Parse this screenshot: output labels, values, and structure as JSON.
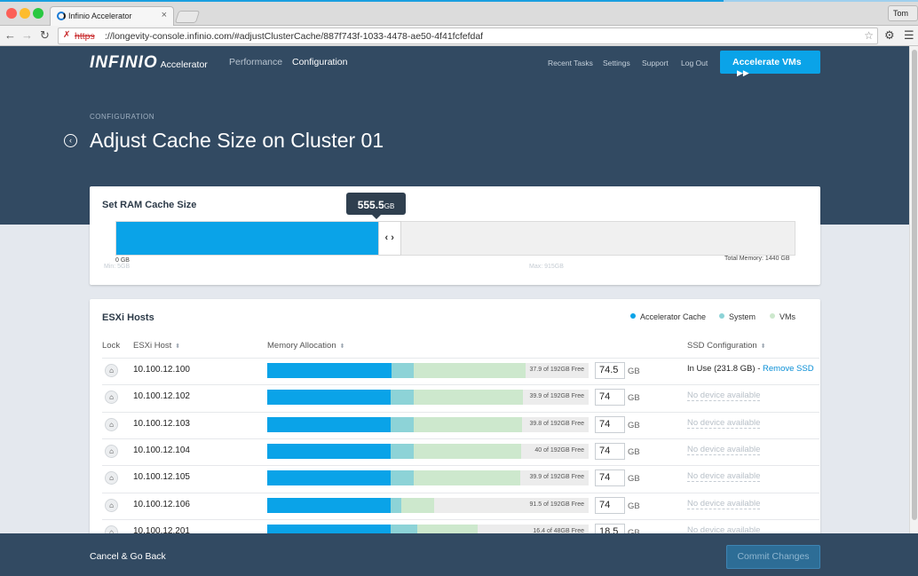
{
  "browser": {
    "tab_title": "Infinio Accelerator",
    "tab_close": "×",
    "profile": "Tom",
    "url_scheme": "https",
    "url_rest": "://longevity-console.infinio.com/#adjustClusterCache/887f743f-1033-4478-ae50-4f41fcfefdaf",
    "icons": {
      "back": "arrow-left",
      "forward": "arrow-right",
      "reload": "reload",
      "bookmark": "star",
      "settings": "gear",
      "menu": "hamburger"
    }
  },
  "header": {
    "logo": "INFINIO",
    "product": "Accelerator",
    "nav": [
      "Performance",
      "Configuration"
    ],
    "links": [
      "Recent Tasks",
      "Settings",
      "Support",
      "Log Out"
    ],
    "accelerate_button": "Accelerate VMs",
    "accelerate_icon": "▶▶",
    "breadcrumb": "CONFIGURATION",
    "title": "Adjust Cache Size on Cluster 01"
  },
  "ram_cache": {
    "title": "Set RAM Cache Size",
    "tooltip_value": "555.5",
    "tooltip_unit": "GB",
    "handle_icon": "‹ ›",
    "fill_fraction": 0.3857,
    "min_label": "0 GB",
    "min_faint": "Min: 5GB",
    "max_faint": "Max: 915GB",
    "total_label": "Total Memory: 1440 GB"
  },
  "hosts": {
    "title": "ESXi Hosts",
    "legend": [
      {
        "label": "Accelerator Cache",
        "color": "#0aa3e8"
      },
      {
        "label": "System",
        "color": "#8dd3d7"
      },
      {
        "label": "VMs",
        "color": "#cde8cd"
      }
    ],
    "columns": [
      "Lock",
      "ESXi Host",
      "Memory Allocation",
      "SSD Configuration"
    ],
    "sort_icon": "⬍",
    "unit": "GB",
    "rows": [
      {
        "ip": "10.100.12.100",
        "acc": 0.388,
        "sys": 0.069,
        "vms": 0.348,
        "free": "37.9 of 192GB Free",
        "gb": "74.5",
        "ssd_status": "In Use (231.8 GB) - ",
        "ssd_link": "Remove SSD"
      },
      {
        "ip": "10.100.12.102",
        "acc": 0.385,
        "sys": 0.072,
        "vms": 0.338,
        "free": "39.9 of 192GB Free",
        "gb": "74",
        "ssd_none": "No device available"
      },
      {
        "ip": "10.100.12.103",
        "acc": 0.385,
        "sys": 0.072,
        "vms": 0.337,
        "free": "39.8 of 192GB Free",
        "gb": "74",
        "ssd_none": "No device available"
      },
      {
        "ip": "10.100.12.104",
        "acc": 0.385,
        "sys": 0.072,
        "vms": 0.334,
        "free": "40 of 192GB Free",
        "gb": "74",
        "ssd_none": "No device available"
      },
      {
        "ip": "10.100.12.105",
        "acc": 0.385,
        "sys": 0.072,
        "vms": 0.329,
        "free": "39.9 of 192GB Free",
        "gb": "74",
        "ssd_none": "No device available"
      },
      {
        "ip": "10.100.12.106",
        "acc": 0.385,
        "sys": 0.033,
        "vms": 0.102,
        "free": "91.5 of 192GB Free",
        "gb": "74",
        "ssd_none": "No device available"
      },
      {
        "ip": "10.100.12.201",
        "acc": 0.385,
        "sys": 0.083,
        "vms": 0.188,
        "free": "16.4 of 48GB Free",
        "gb": "18.5",
        "ssd_none": "No device available"
      }
    ]
  },
  "footer": {
    "cancel": "Cancel & Go Back",
    "commit": "Commit Changes"
  }
}
